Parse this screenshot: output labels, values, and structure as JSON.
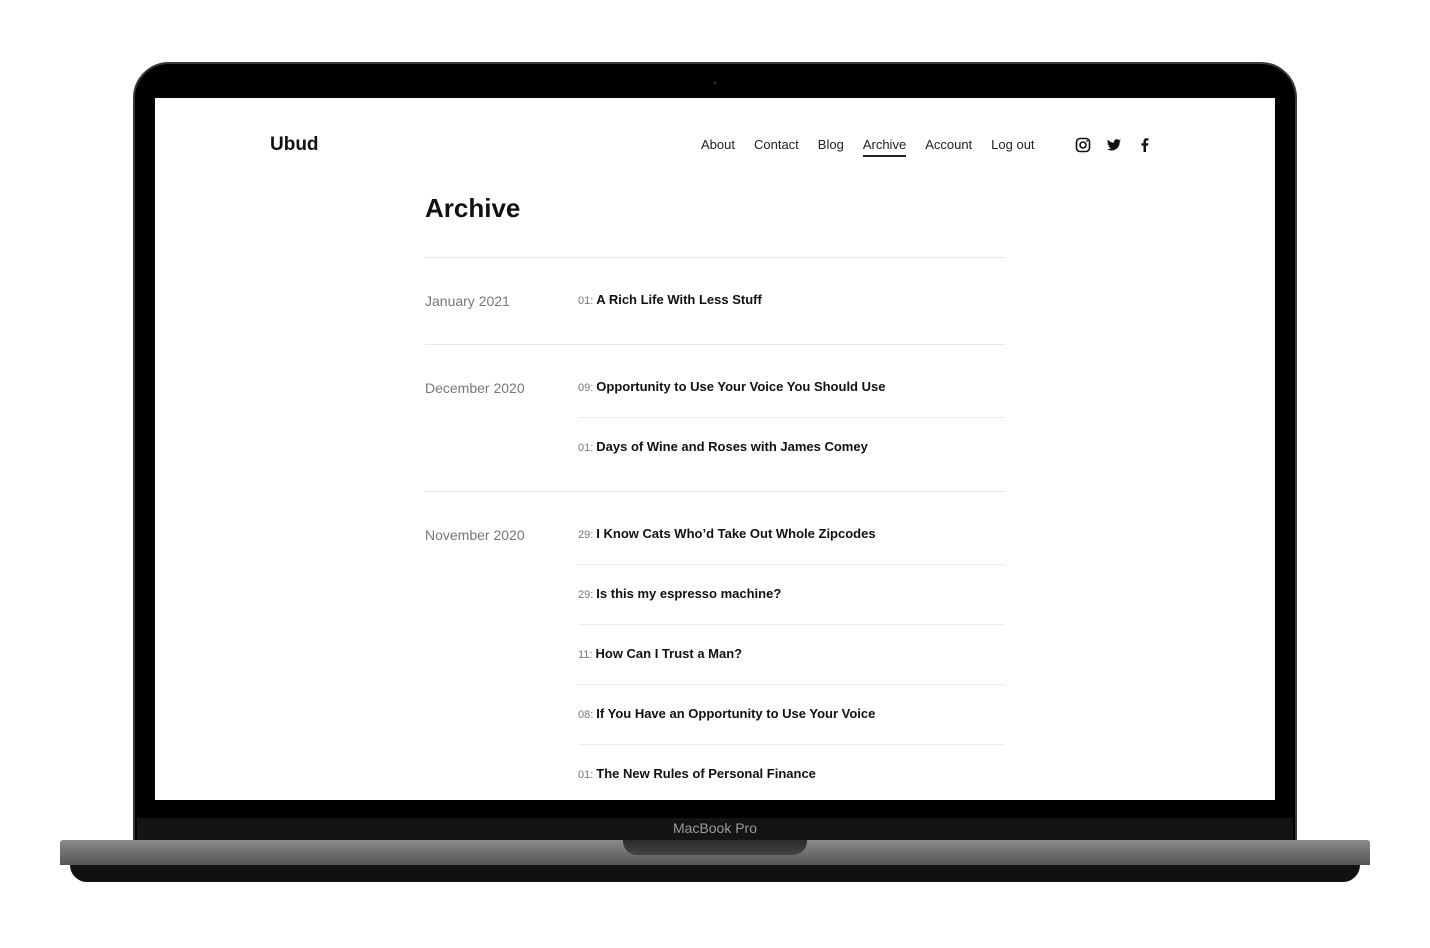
{
  "device_label": "MacBook Pro",
  "site": {
    "logo": "Ubud"
  },
  "nav": [
    {
      "label": "About"
    },
    {
      "label": "Contact"
    },
    {
      "label": "Blog"
    },
    {
      "label": "Archive",
      "active": true
    },
    {
      "label": "Account"
    },
    {
      "label": "Log out"
    }
  ],
  "social": [
    "instagram-icon",
    "twitter-icon",
    "facebook-icon"
  ],
  "page_title": "Archive",
  "archive": [
    {
      "month": "January 2021",
      "posts": [
        {
          "day": "01:",
          "title": "A Rich Life With Less Stuff"
        }
      ]
    },
    {
      "month": "December 2020",
      "posts": [
        {
          "day": "09:",
          "title": "Opportunity to Use Your Voice You Should Use"
        },
        {
          "day": "01:",
          "title": "Days of Wine and Roses with James Comey"
        }
      ]
    },
    {
      "month": "November 2020",
      "posts": [
        {
          "day": "29:",
          "title": "I Know Cats Who’d Take Out Whole Zipcodes"
        },
        {
          "day": "29:",
          "title": "Is this my espresso machine?"
        },
        {
          "day": "11:",
          "title": "How Can I Trust a Man?"
        },
        {
          "day": "08:",
          "title": "If You Have an Opportunity to Use Your Voice"
        },
        {
          "day": "01:",
          "title": "The New Rules of Personal Finance"
        }
      ]
    }
  ]
}
